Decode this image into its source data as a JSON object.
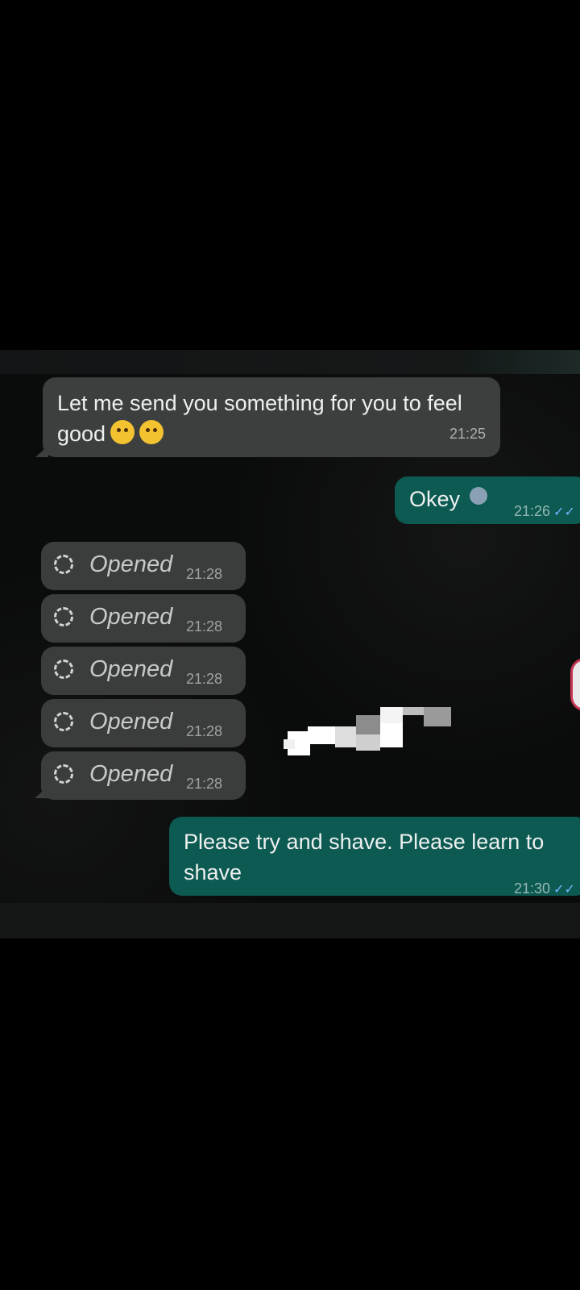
{
  "conversation": {
    "msg1": {
      "text": "Let me send you something for you to feel good",
      "emojis": [
        "smiling-face-icon",
        "shushing-face-icon"
      ],
      "time": "21:25"
    },
    "msg2": {
      "text": "Okey",
      "emoji": "sweat-emoji-icon",
      "time": "21:26",
      "status": "read-ticks-icon"
    },
    "opened_items": [
      {
        "label": "Opened",
        "time": "21:28"
      },
      {
        "label": "Opened",
        "time": "21:28"
      },
      {
        "label": "Opened",
        "time": "21:28"
      },
      {
        "label": "Opened",
        "time": "21:28"
      },
      {
        "label": "Opened",
        "time": "21:28"
      }
    ],
    "msg3": {
      "text": "Please try and shave. Please learn to shave",
      "time": "21:30",
      "status": "read-ticks-icon"
    }
  },
  "colors": {
    "incoming_bubble": "#3d3f3e",
    "outgoing_bubble": "#0c5a52",
    "tick_blue": "#6fb6ff"
  }
}
